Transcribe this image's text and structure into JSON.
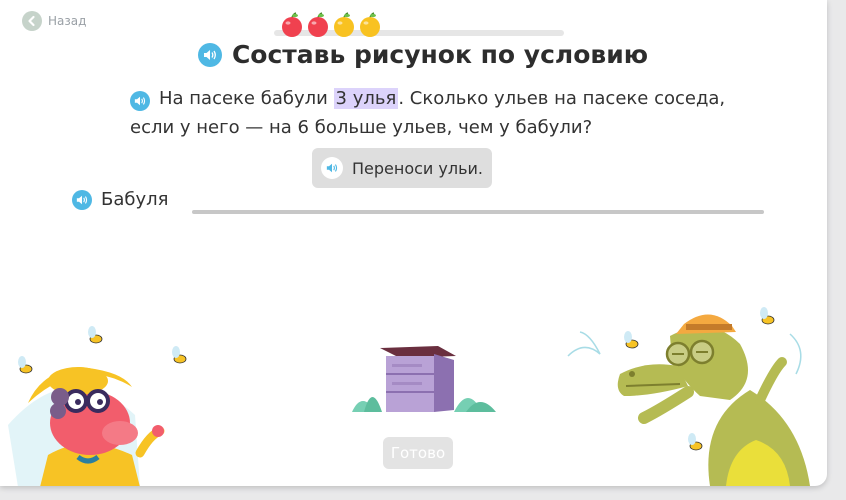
{
  "nav": {
    "back_label": "Назад"
  },
  "progress": {
    "fruits": [
      "apple-red",
      "apple-red",
      "apple-yellow",
      "apple-yellow"
    ]
  },
  "header": {
    "title": "Составь рисунок по условию"
  },
  "task": {
    "text_before": "На пасеке бабули ",
    "highlight": "3 улья",
    "text_after": ". Сколько ульев на пасеке соседа, если у него — на 6 больше ульев, чем у бабули?"
  },
  "hint": {
    "label": "Переноси ульи."
  },
  "rows": {
    "grandma_label": "Бабуля"
  },
  "actions": {
    "done_label": "Готово"
  },
  "colors": {
    "speaker": "#4fb8e4",
    "highlight": "#dcd3fb",
    "hive": "#a58bc4",
    "crocodile": "#b5bb53",
    "dragon": "#f25d6c"
  }
}
